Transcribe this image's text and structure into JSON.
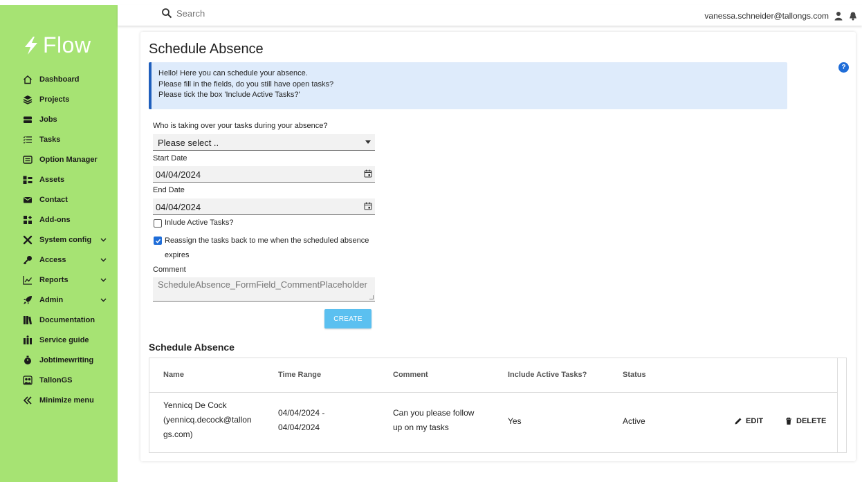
{
  "app": {
    "logo_text": "Flow"
  },
  "sidebar": {
    "items": [
      {
        "label": "Dashboard",
        "icon": "home-icon"
      },
      {
        "label": "Projects",
        "icon": "layers-icon"
      },
      {
        "label": "Jobs",
        "icon": "jobs-icon"
      },
      {
        "label": "Tasks",
        "icon": "checklist-icon"
      },
      {
        "label": "Option Manager",
        "icon": "list-icon"
      },
      {
        "label": "Assets",
        "icon": "assets-icon"
      },
      {
        "label": "Contact",
        "icon": "mail-icon"
      },
      {
        "label": "Add-ons",
        "icon": "puzzle-icon"
      },
      {
        "label": "System config",
        "icon": "tools-icon",
        "expandable": true
      },
      {
        "label": "Access",
        "icon": "key-icon",
        "expandable": true
      },
      {
        "label": "Reports",
        "icon": "chart-icon",
        "expandable": true
      },
      {
        "label": "Admin",
        "icon": "rocket-icon",
        "expandable": true
      },
      {
        "label": "Documentation",
        "icon": "books-icon"
      },
      {
        "label": "Service guide",
        "icon": "guide-icon"
      },
      {
        "label": "Jobtimewriting",
        "icon": "stopwatch-icon"
      },
      {
        "label": "TallonGS",
        "icon": "people-icon"
      },
      {
        "label": "Minimize menu",
        "icon": "double-chevron-left-icon"
      }
    ]
  },
  "topbar": {
    "search_placeholder": "Search",
    "user_email": "vanessa.schneider@tallongs.com"
  },
  "page": {
    "title": "Schedule Absence",
    "info_lines": [
      "Hello! Here you can schedule your absence.",
      "Please fill in the fields, do you still have open tasks?",
      "Please tick the box 'Include Active Tasks?'"
    ],
    "form": {
      "takeover_label": "Who is taking over your tasks during your absence?",
      "takeover_value": "Please select ..",
      "start_label": "Start Date",
      "start_value": "04/04/2024",
      "end_label": "End Date",
      "end_value": "04/04/2024",
      "include_active_label": "Inlude Active Tasks?",
      "include_active_checked": false,
      "reassign_label_line1": "Reassign the tasks back to me when the scheduled absence",
      "reassign_label_line2": "expires",
      "reassign_checked": true,
      "comment_label": "Comment",
      "comment_placeholder": "ScheduleAbsence_FormField_CommentPlaceholder",
      "create_label": "CREATE"
    },
    "table": {
      "title": "Schedule Absence",
      "headers": [
        "Name",
        "Time Range",
        "Comment",
        "Include Active Tasks?",
        "Status"
      ],
      "rows": [
        {
          "name_lines": [
            "Yennicq De Cock",
            "(yennicq.decock@tallon",
            "gs.com)"
          ],
          "range_lines": [
            "04/04/2024 -",
            "04/04/2024"
          ],
          "comment_lines": [
            "Can you please follow",
            "up on my tasks"
          ],
          "include_active": "Yes",
          "status": "Active",
          "edit_label": "EDIT",
          "delete_label": "DELETE"
        }
      ]
    }
  },
  "colors": {
    "sidebar_bg": "#a6e373",
    "info_bg": "#deebfb",
    "info_border": "#1f5fbd",
    "create_button": "#5bc0f0",
    "checkbox_checked": "#1f6dd8"
  }
}
